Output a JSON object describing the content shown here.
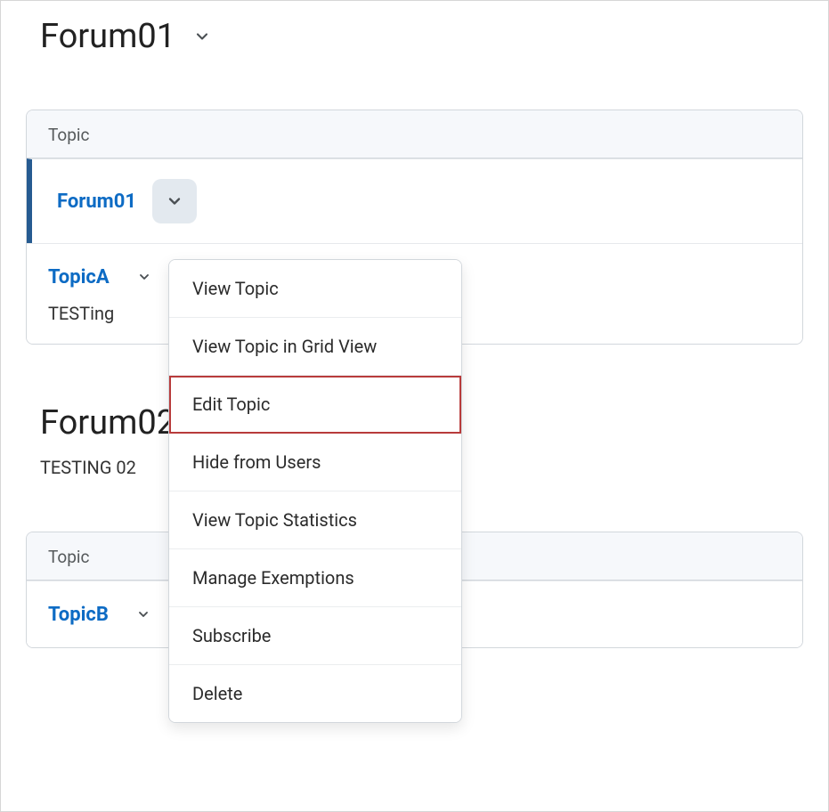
{
  "forum1": {
    "title": "Forum01",
    "tableHeader": "Topic",
    "row1": {
      "name": "Forum01"
    },
    "row2": {
      "name": "TopicA",
      "desc": "TESTing"
    }
  },
  "forum2": {
    "title": "Forum02",
    "desc": "TESTING 02",
    "tableHeader": "Topic",
    "row1": {
      "name": "TopicB"
    }
  },
  "menu": {
    "viewTopic": "View Topic",
    "viewGrid": "View Topic in Grid View",
    "editTopic": "Edit Topic",
    "hide": "Hide from Users",
    "stats": "View Topic Statistics",
    "manage": "Manage Exemptions",
    "subscribe": "Subscribe",
    "delete": "Delete"
  }
}
